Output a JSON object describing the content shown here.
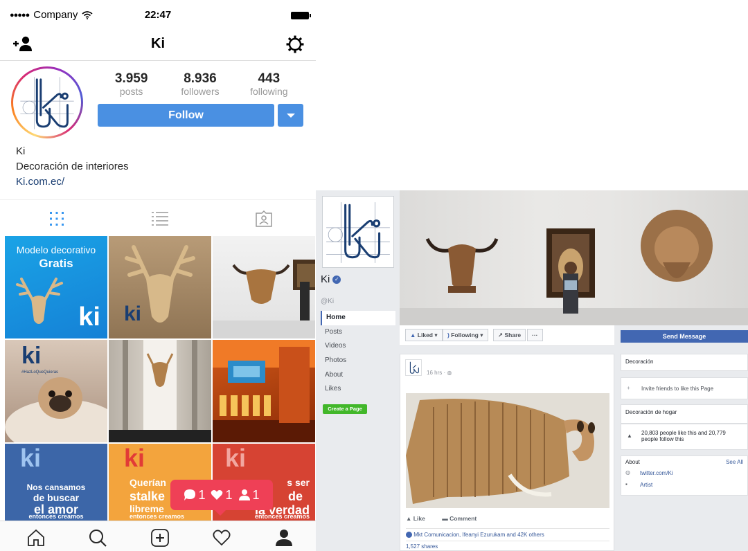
{
  "status_bar": {
    "carrier": "Company",
    "time": "22:47"
  },
  "instagram": {
    "username": "Ki",
    "stats": [
      {
        "value": "3.959",
        "label": "posts"
      },
      {
        "value": "8.936",
        "label": "followers"
      },
      {
        "value": "443",
        "label": "following"
      }
    ],
    "follow_label": "Follow",
    "bio": {
      "name": "Ki",
      "description": "Decoración de interiores",
      "link": "Ki.com.ec/"
    },
    "grid_posts": [
      {
        "line1": "Modelo decorativo",
        "line2": "Gratis",
        "brand": "ki"
      },
      {
        "brand": "ki"
      },
      {
        "brand": ""
      },
      {
        "brand": "ki",
        "hashtag": "#HazLoQueQuieras"
      },
      {
        "brand": ""
      },
      {
        "brand": ""
      },
      {
        "brand": "ki",
        "line1": "Nos cansamos",
        "line2": "de buscar",
        "line3": "el amor",
        "line4": "entonces creamos"
      },
      {
        "brand": "ki",
        "line1": "Querían",
        "line2": "stalke",
        "line3": "libreme",
        "line4": "entonces creamos"
      },
      {
        "brand": "ki",
        "line1": "s ser",
        "line2": "de",
        "line3": "la verdad",
        "line4": "entonces creamos"
      }
    ],
    "notifications": {
      "comments": "1",
      "likes": "1",
      "follows": "1"
    },
    "colors": {
      "follow_blue": "#4a90e2",
      "notif_red": "#ef4056",
      "brand_blue": "#1a3e72"
    }
  },
  "facebook": {
    "page_name": "Ki",
    "handle": "@Ki",
    "nav": [
      "Home",
      "Posts",
      "Videos",
      "Photos",
      "About",
      "Likes"
    ],
    "create_page_label": "Create a Page",
    "actions": {
      "liked": "Liked",
      "following": "Following",
      "share": "Share",
      "more": "···"
    },
    "send_message": "Send Message",
    "post": {
      "time": "16 hrs · ",
      "like_label": "Like",
      "comment_label": "Comment",
      "reactions": "Mkt Comunicacion, Ifeanyi Ezurukam and 42K others",
      "shares": "1,527 shares"
    },
    "sidebar": {
      "category": "Decoración",
      "invite": "Invite friends to like this Page",
      "category2": "Decoración de hogar",
      "likes_text": "20,803 people like this and 20,779 people follow this",
      "about_label": "About",
      "see_all": "See All",
      "twitter": "twitter.com/Ki",
      "artist": "Artist"
    },
    "colors": {
      "fb_blue": "#4267b2",
      "create_green": "#42b72a",
      "bg": "#e9ebee"
    }
  }
}
